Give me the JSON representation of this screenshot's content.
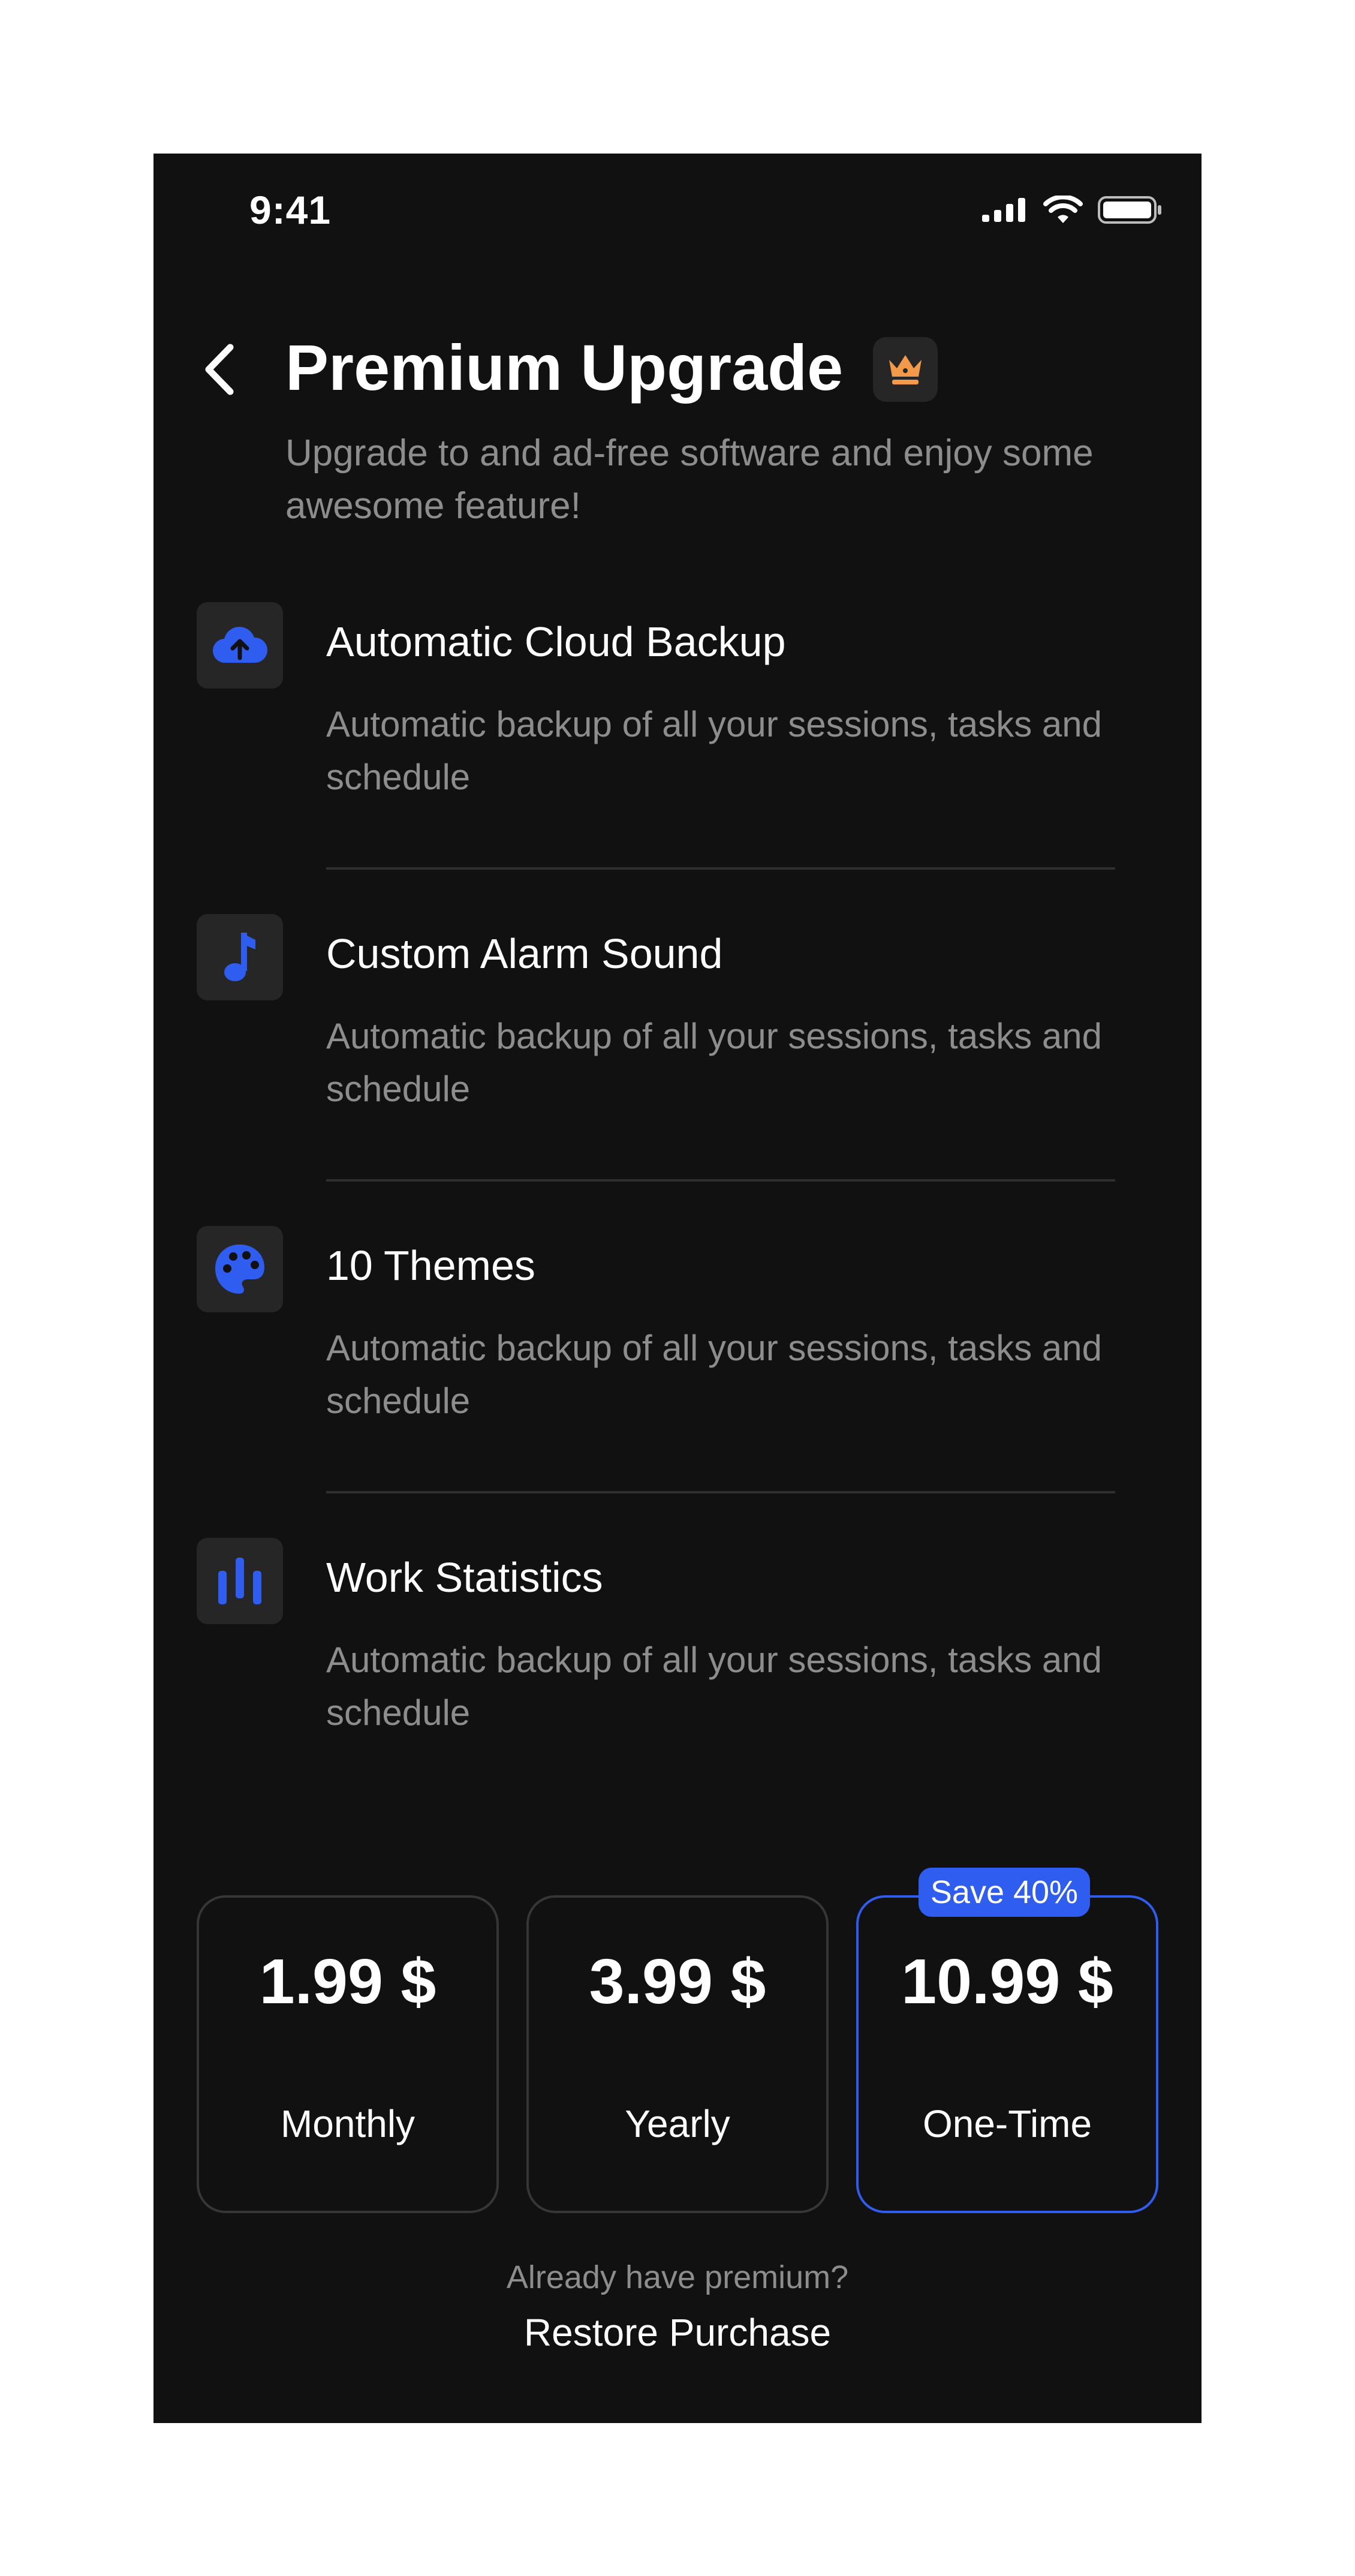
{
  "status_bar": {
    "time": "9:41"
  },
  "header": {
    "title": "Premium Upgrade",
    "subtitle": "Upgrade to and ad-free software and enjoy some awesome feature!",
    "crown_icon": "crown-icon",
    "crown_color": "#f29a4a"
  },
  "features": [
    {
      "icon": "cloud-upload-icon",
      "title": "Automatic Cloud Backup",
      "description": "Automatic backup of all your sessions, tasks and schedule"
    },
    {
      "icon": "music-note-icon",
      "title": "Custom Alarm Sound",
      "description": "Automatic backup of all your sessions, tasks and schedule"
    },
    {
      "icon": "palette-icon",
      "title": "10 Themes",
      "description": "Automatic backup of all your sessions, tasks and schedule"
    },
    {
      "icon": "bar-stats-icon",
      "title": "Work Statistics",
      "description": "Automatic backup of all your sessions, tasks and schedule"
    }
  ],
  "plans": [
    {
      "price": "1.99 $",
      "label": "Monthly",
      "selected": false
    },
    {
      "price": "3.99 $",
      "label": "Yearly",
      "selected": false
    },
    {
      "price": "10.99 $",
      "label": "One-Time",
      "selected": true,
      "badge": "Save 40%"
    }
  ],
  "footer": {
    "already_text": "Already have premium?",
    "restore_label": "Restore Purchase"
  },
  "colors": {
    "background": "#111111",
    "accent": "#2e5df0",
    "muted_text": "#8d8d8d",
    "icon_tile": "#262626"
  }
}
